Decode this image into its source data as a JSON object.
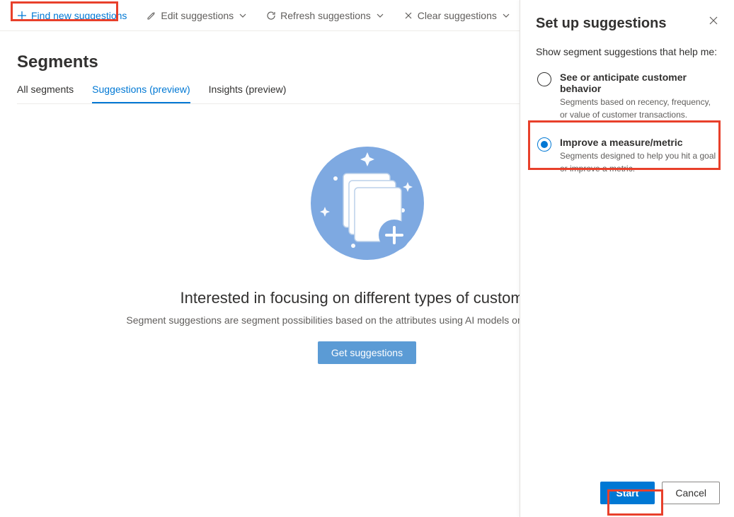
{
  "toolbar": {
    "find": "Find new suggestions",
    "edit": "Edit suggestions",
    "refresh": "Refresh suggestions",
    "clear": "Clear suggestions"
  },
  "page": {
    "title": "Segments"
  },
  "tabs": {
    "all": "All segments",
    "suggestions": "Suggestions (preview)",
    "insights": "Insights (preview)"
  },
  "empty": {
    "heading": "Interested in focusing on different types of customers?",
    "sub": "Segment suggestions are segment possibilities based on the attributes using AI models or based on activities.",
    "button": "Get suggestions"
  },
  "panel": {
    "title": "Set up suggestions",
    "lead": "Show segment suggestions that help me:",
    "options": [
      {
        "title": "See or anticipate customer behavior",
        "desc": "Segments based on recency, frequency, or value of customer transactions."
      },
      {
        "title": "Improve a measure/metric",
        "desc": "Segments designed to help you hit a goal or improve a metric."
      }
    ],
    "start": "Start",
    "cancel": "Cancel"
  }
}
